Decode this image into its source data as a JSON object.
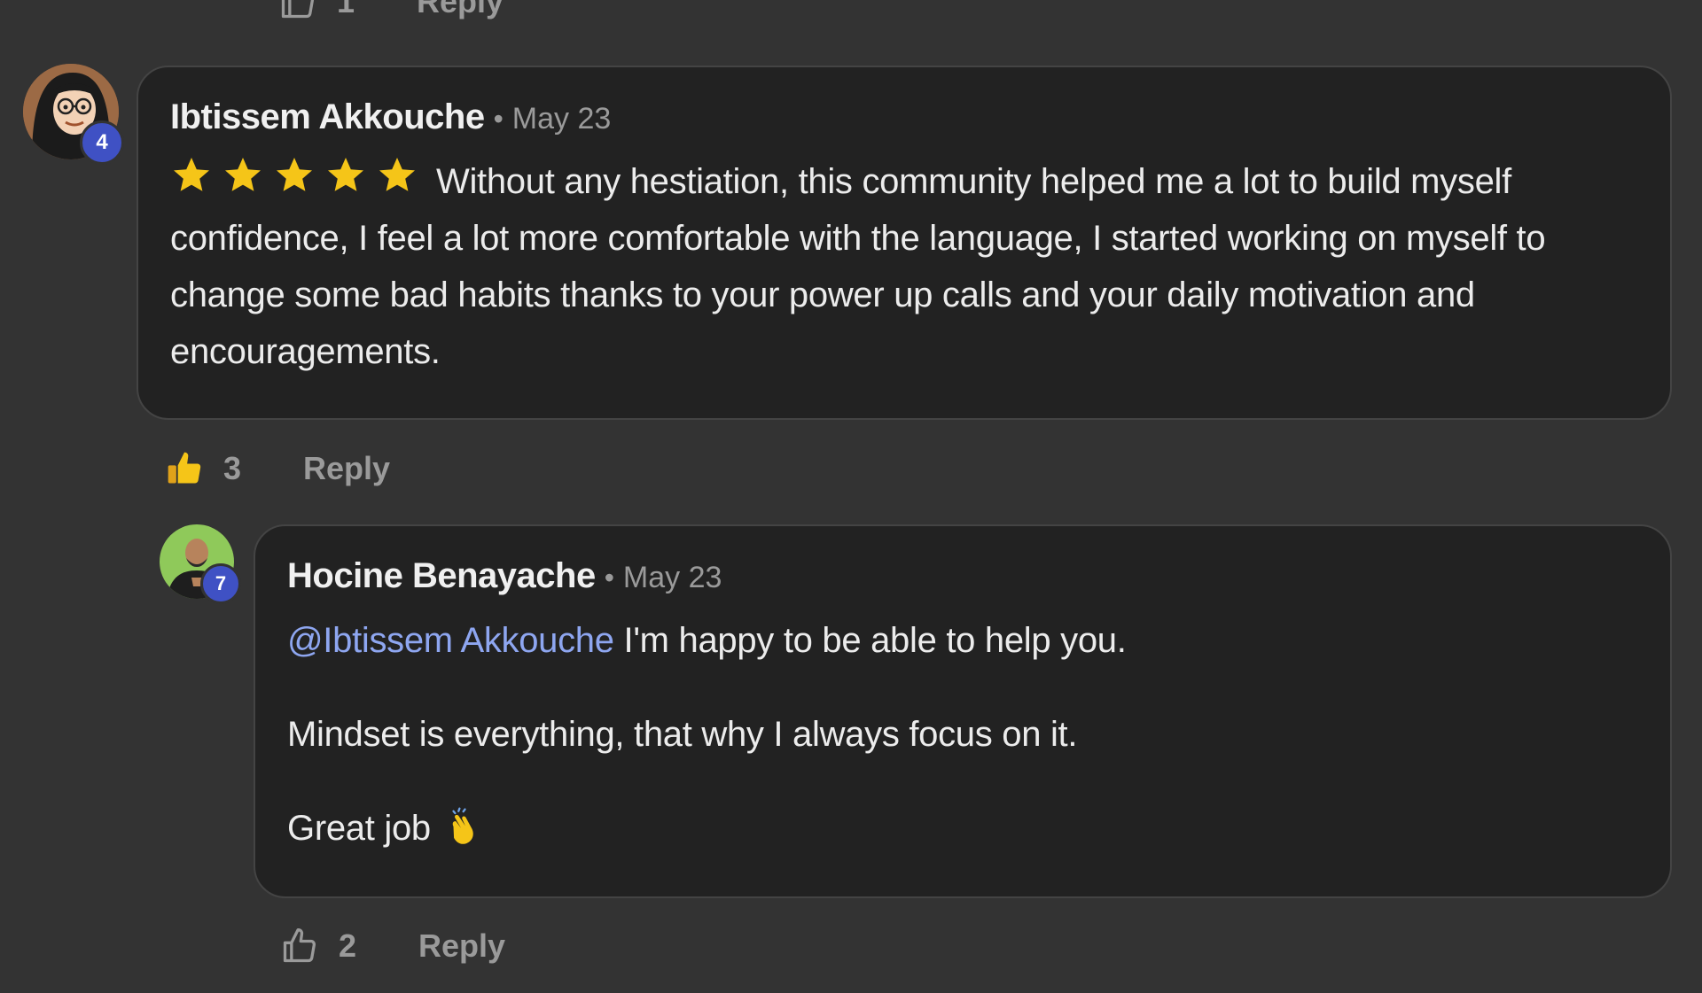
{
  "comments": [
    {
      "author": "Ibtissem Akkouche",
      "separator": "•",
      "date": "May 23",
      "level": "4",
      "rating_stars": 5,
      "text": "Without any hestiation, this community helped me a lot to build myself confidence, I feel a lot more comfortable with the language, I started working on myself to change some bad habits thanks to your power up calls and your daily motivation and encouragements.",
      "likes": "3",
      "reply_label": "Reply",
      "liked": true
    },
    {
      "author": "Hocine Benayache",
      "separator": "•",
      "date": "May 23",
      "level": "7",
      "mention": "@Ibtissem Akkouche",
      "line1": "I'm happy to be able to help you.",
      "line2": "Mindset is everything, that why I always focus on it.",
      "line3": "Great job",
      "line3_emoji": "clapping-hands",
      "likes": "2",
      "reply_label": "Reply",
      "liked": false
    }
  ],
  "top_partial": {
    "likes": "1",
    "reply_label": "Reply"
  },
  "colors": {
    "background": "#333333",
    "bubble": "#222222",
    "muted": "#9a9a9a",
    "mention": "#8ea6f0",
    "badge": "#3f51c4",
    "star": "#f5c518"
  }
}
